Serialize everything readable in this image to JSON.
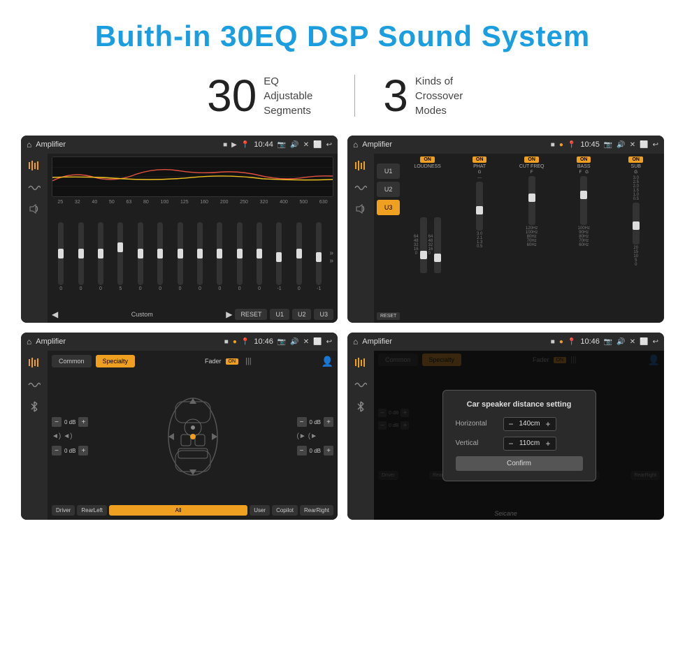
{
  "page": {
    "title": "Buith-in 30EQ DSP Sound System",
    "stat1_number": "30",
    "stat1_label": "EQ Adjustable\nSegments",
    "stat2_number": "3",
    "stat2_label": "Kinds of\nCrossover Modes"
  },
  "screens": {
    "screen1": {
      "title": "Amplifier",
      "time": "10:44",
      "freq_labels": [
        "25",
        "32",
        "40",
        "50",
        "63",
        "80",
        "100",
        "125",
        "160",
        "200",
        "250",
        "320",
        "400",
        "500",
        "630"
      ],
      "slider_values": [
        "0",
        "0",
        "0",
        "0",
        "5",
        "0",
        "0",
        "0",
        "0",
        "0",
        "0",
        "0",
        "-1",
        "0",
        "-1"
      ],
      "bottom_label": "Custom",
      "buttons": [
        "RESET",
        "U1",
        "U2",
        "U3"
      ]
    },
    "screen2": {
      "title": "Amplifier",
      "time": "10:45",
      "presets": [
        "U1",
        "U2",
        "U3"
      ],
      "active_preset": "U3",
      "sections": [
        "LOUDNESS",
        "PHAT",
        "CUT FREQ",
        "BASS",
        "SUB"
      ],
      "reset": "RESET"
    },
    "screen3": {
      "title": "Amplifier",
      "time": "10:46",
      "tab_common": "Common",
      "tab_specialty": "Specialty",
      "active_tab": "Specialty",
      "fader_label": "Fader",
      "fader_on": "ON",
      "db_values": [
        "0 dB",
        "0 dB",
        "0 dB",
        "0 dB"
      ],
      "buttons": [
        "Driver",
        "RearLeft",
        "All",
        "User",
        "Copilot",
        "RearRight"
      ]
    },
    "screen4": {
      "title": "Amplifier",
      "time": "10:46",
      "tab_common": "Common",
      "tab_specialty": "Specialty",
      "dialog_title": "Car speaker distance setting",
      "horizontal_label": "Horizontal",
      "horizontal_value": "140cm",
      "vertical_label": "Vertical",
      "vertical_value": "110cm",
      "confirm_label": "Confirm",
      "db_values": [
        "0 dB",
        "0 dB"
      ],
      "buttons": [
        "Driver",
        "RearLeft",
        "All",
        "User",
        "Copilot",
        "RearRight"
      ]
    }
  },
  "watermark": "Seicane"
}
